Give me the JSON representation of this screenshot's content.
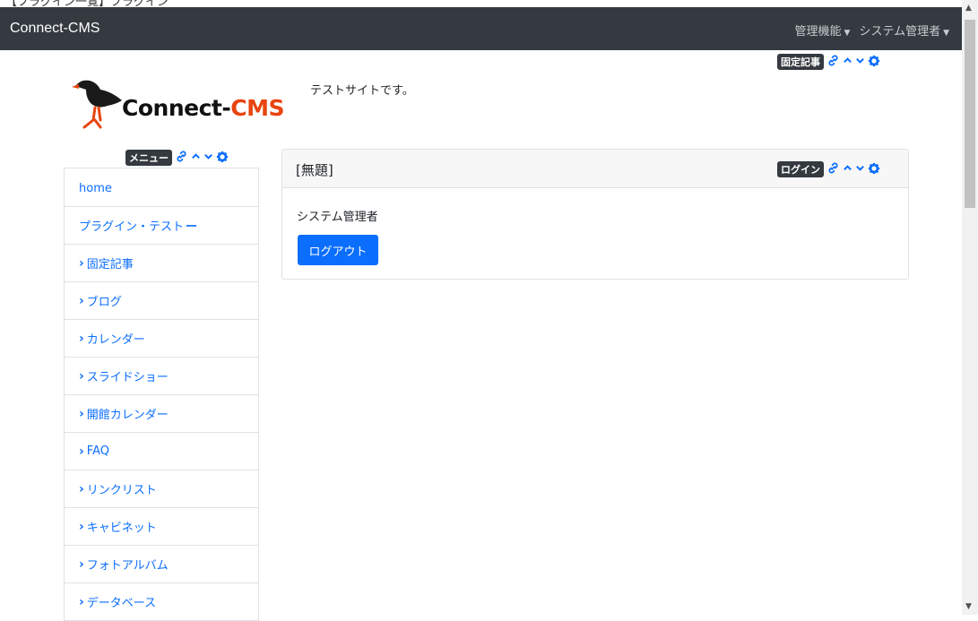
{
  "top_strip": "【フラグイン一覧】プラグイン",
  "navbar": {
    "brand": "Connect-CMS",
    "admin_menu": "管理機能",
    "user_menu": "システム管理者"
  },
  "site": {
    "logo_prefix": "Conn",
    "logo_mid": "ect-",
    "logo_suffix": "CMS",
    "description": "テストサイトです。"
  },
  "frames": {
    "fixed_article_badge": "固定記事",
    "menu_badge": "メニュー",
    "login_badge": "ログイン"
  },
  "menu": {
    "items": [
      {
        "label": "home",
        "chevron": false,
        "suffix": ""
      },
      {
        "label": "プラグイン・テスト",
        "chevron": false,
        "suffix": "ー"
      },
      {
        "label": "固定記事",
        "chevron": true,
        "suffix": ""
      },
      {
        "label": "ブログ",
        "chevron": true,
        "suffix": ""
      },
      {
        "label": "カレンダー",
        "chevron": true,
        "suffix": ""
      },
      {
        "label": "スライドショー",
        "chevron": true,
        "suffix": ""
      },
      {
        "label": "開館カレンダー",
        "chevron": true,
        "suffix": ""
      },
      {
        "label": "FAQ",
        "chevron": true,
        "suffix": ""
      },
      {
        "label": "リンクリスト",
        "chevron": true,
        "suffix": ""
      },
      {
        "label": "キャビネット",
        "chevron": true,
        "suffix": ""
      },
      {
        "label": "フォトアルバム",
        "chevron": true,
        "suffix": ""
      },
      {
        "label": "データベース",
        "chevron": true,
        "suffix": ""
      }
    ]
  },
  "login_card": {
    "title": "[無題]",
    "user_name": "システム管理者",
    "logout_label": "ログアウト"
  },
  "colors": {
    "navbar": "#343a40",
    "link": "#0b6efd",
    "button": "#0b6efd",
    "badge": "#343a40"
  }
}
